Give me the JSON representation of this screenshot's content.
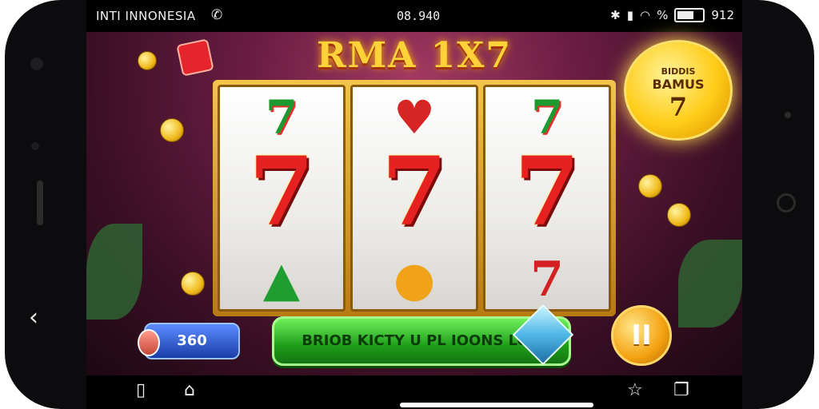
{
  "status_bar": {
    "carrier": "INTI INNONESIA",
    "time": "08.940",
    "battery_text": "%",
    "extra": "912"
  },
  "game": {
    "title": "RMA 1X7",
    "bonus_badge": {
      "line1": "BIDDIS",
      "line2": "BAMUS",
      "number": "7"
    },
    "reels": [
      {
        "top": "7",
        "middle": "7",
        "bottom": "▲"
      },
      {
        "top": "♥",
        "middle": "7",
        "bottom": "●"
      },
      {
        "top": "7",
        "middle": "7",
        "bottom": "7"
      }
    ],
    "bet_button": "360",
    "spin_button": "BRIOB KICTY U PL IOONS LON",
    "pause_button": "II"
  },
  "colors": {
    "accent": "#ffd23a",
    "spin_green": "#1f9e1a",
    "seven_red": "#e52121"
  },
  "icons": {
    "back": "chevron-left-icon",
    "recent": "square-icon",
    "home": "home-icon",
    "star": "star-icon",
    "overview": "copy-icon"
  }
}
